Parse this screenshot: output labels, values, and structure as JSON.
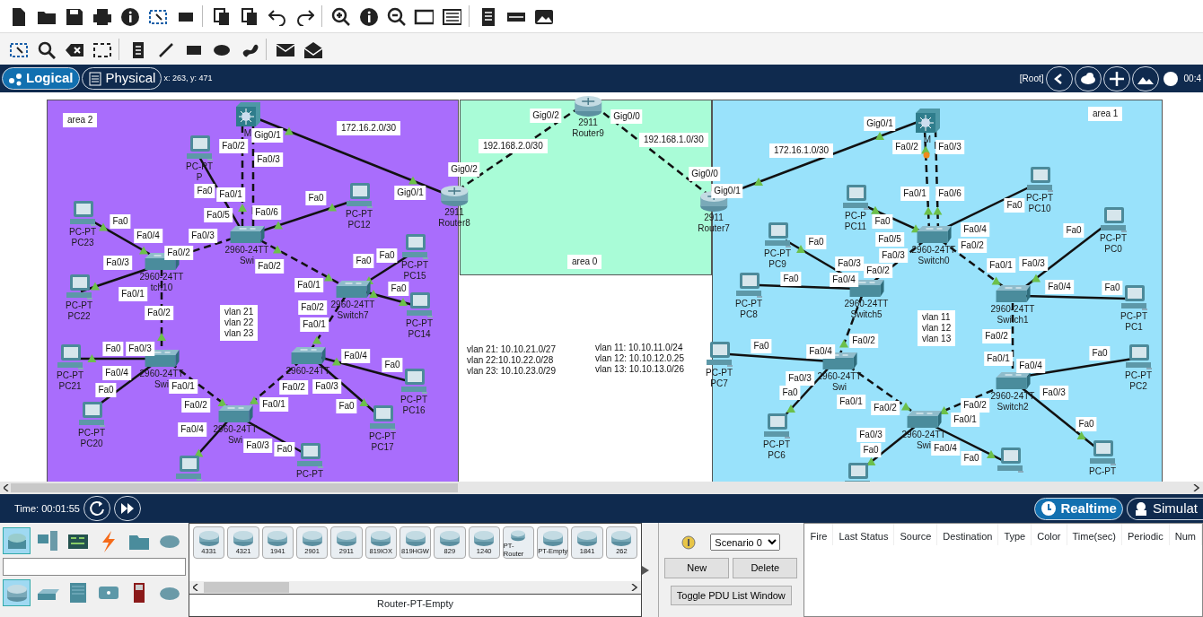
{
  "workspace_tabs": [
    {
      "label": "Logical",
      "selected": true
    },
    {
      "label": "Physical",
      "selected": false
    }
  ],
  "coordinates": "x: 263, y: 471",
  "root_label": "[Root]",
  "clock": "00:4",
  "canvas": {
    "areas": [
      {
        "color": "#a96dfc"
      },
      {
        "color": "#a9fcd7"
      },
      {
        "color": "#99e2fb"
      }
    ],
    "notes": [
      {
        "lines": [
          "area 2"
        ]
      },
      {
        "lines": [
          "172.16.2.0/30"
        ]
      },
      {
        "lines": [
          "vlan 21",
          "vlan 22",
          "vlan 23"
        ]
      },
      {
        "lines": [
          "192.168.2.0/30"
        ]
      },
      {
        "lines": [
          "192.168.1.0/30"
        ]
      },
      {
        "lines": [
          "area 0"
        ]
      },
      {
        "lines": [
          "vlan 21: 10.10.21.0/27",
          "vlan 22:10.10.22.0/28",
          "vlan 23: 10.10.23.0/29"
        ]
      },
      {
        "lines": [
          "vlan 11: 10.10.11.0/24",
          "vlan 12: 10.10.12.0.25",
          "vlan 13: 10.10.13.0/26"
        ]
      },
      {
        "lines": [
          "172.16.1.0/30"
        ]
      },
      {
        "lines": [
          "area 1"
        ]
      },
      {
        "lines": [
          "vlan 11",
          "vlan 12",
          "vlan 13"
        ]
      }
    ],
    "devices": [
      {
        "kind": "multilayer",
        "labels": [
          "M"
        ]
      },
      {
        "kind": "pc",
        "labels": [
          "PC-PT",
          "P"
        ]
      },
      {
        "kind": "pc",
        "labels": [
          "PC-PT",
          "PC12"
        ]
      },
      {
        "kind": "pc",
        "labels": [
          "PC-PT",
          "PC23"
        ]
      },
      {
        "kind": "switch",
        "labels": [
          "2960-24TT",
          "Swi"
        ]
      },
      {
        "kind": "switch",
        "labels": [
          "2960-24TT",
          "tch10"
        ]
      },
      {
        "kind": "pc",
        "labels": [
          "PC-PT",
          "PC22"
        ]
      },
      {
        "kind": "pc",
        "labels": [
          "PC-PT",
          "PC15"
        ]
      },
      {
        "kind": "switch",
        "labels": [
          "2960-24TT",
          "Switch7"
        ]
      },
      {
        "kind": "pc",
        "labels": [
          "PC-PT",
          "PC14"
        ]
      },
      {
        "kind": "pc",
        "labels": [
          "PC-PT",
          "PC21"
        ]
      },
      {
        "kind": "switch",
        "labels": [
          "2960-24TT",
          "Swi"
        ]
      },
      {
        "kind": "switch",
        "labels": [
          "2960-24TT"
        ]
      },
      {
        "kind": "pc",
        "labels": [
          "PC-PT",
          "PC16"
        ]
      },
      {
        "kind": "pc",
        "labels": [
          "PC-PT",
          "PC20"
        ]
      },
      {
        "kind": "switch",
        "labels": [
          "2960-24TT",
          "Swi"
        ]
      },
      {
        "kind": "pc",
        "labels": [
          "PC-PT",
          "PC17"
        ]
      },
      {
        "kind": "pc"
      },
      {
        "kind": "pc",
        "labels": [
          "PC-PT"
        ]
      },
      {
        "kind": "router",
        "labels": [
          "2911",
          "Router9"
        ]
      },
      {
        "kind": "router",
        "labels": [
          "2911",
          "Router8"
        ]
      },
      {
        "kind": "router",
        "labels": [
          "2911",
          "Router7"
        ]
      },
      {
        "kind": "multilayer",
        "labels": [
          "M"
        ]
      },
      {
        "kind": "pc",
        "labels": [
          "PC-P",
          "PC11"
        ]
      },
      {
        "kind": "pc",
        "labels": [
          "PC-PT",
          "PC10"
        ]
      },
      {
        "kind": "switch",
        "labels": [
          "2960-24TT",
          "Switch0"
        ]
      },
      {
        "kind": "pc",
        "labels": [
          "PC-PT",
          "PC0"
        ]
      },
      {
        "kind": "pc",
        "labels": [
          "PC-PT",
          "PC9"
        ]
      },
      {
        "kind": "pc",
        "labels": [
          "PC-PT",
          "PC8"
        ]
      },
      {
        "kind": "switch",
        "labels": [
          "2960-24TT",
          "Switch5"
        ]
      },
      {
        "kind": "switch",
        "labels": [
          "2960-24TT",
          "Switch1"
        ]
      },
      {
        "kind": "pc",
        "labels": [
          "PC-PT",
          "PC1"
        ]
      },
      {
        "kind": "pc",
        "labels": [
          "PC-PT",
          "PC7"
        ]
      },
      {
        "kind": "switch",
        "labels": [
          "2960-24TT",
          "Swi"
        ]
      },
      {
        "kind": "switch",
        "labels": [
          "2960-24TT",
          "Switch2"
        ]
      },
      {
        "kind": "pc",
        "labels": [
          "PC-PT",
          "PC2"
        ]
      },
      {
        "kind": "switch",
        "labels": [
          "2960-24TT",
          "Swi"
        ]
      },
      {
        "kind": "pc",
        "labels": [
          "PC-PT",
          "PC6"
        ]
      },
      {
        "kind": "pc"
      },
      {
        "kind": "pc"
      },
      {
        "kind": "pc",
        "labels": [
          "PC-PT"
        ]
      }
    ],
    "ports": [
      "Fa0/2",
      "Gig0/1",
      "Fa0/3",
      "Fa0",
      "Fa0/1",
      "Fa0/5",
      "Fa0/6",
      "Fa0",
      "Fa0",
      "Fa0/4",
      "Fa0/3",
      "Fa0/2",
      "Fa0/3",
      "Fa0/2",
      "Fa0/1",
      "Fa0/1",
      "Fa0",
      "Fa0",
      "Fa0",
      "Fa0/2",
      "Fa0/2",
      "Fa0/1",
      "Fa0",
      "Fa0/3",
      "Fa0/4",
      "Fa0",
      "Fa0/1",
      "Fa0/4",
      "Fa0",
      "Fa0/2",
      "Fa0/3",
      "Fa0/2",
      "Fa0/1",
      "Fa0",
      "Fa0/4",
      "Fa0/3",
      "Fa0",
      "Gig0/1",
      "Gig0/2",
      "Gig0/0",
      "Gig0/2",
      "Gig0/0",
      "Gig0/1",
      "Gig0/1",
      "Fa0/2",
      "Fa0/3",
      "Fa0/1",
      "Fa0/6",
      "Fa0",
      "Fa0/5",
      "Fa0",
      "Fa0/4",
      "Fa0/2",
      "Fa0/3",
      "Fa0/2",
      "Fa0",
      "Fa0",
      "Fa0/3",
      "Fa0/1",
      "Fa0/3",
      "Fa0/4",
      "Fa0",
      "Fa0/4",
      "Fa0",
      "Fa0/2",
      "Fa0",
      "Fa0/4",
      "Fa0/3",
      "Fa0",
      "Fa0/1",
      "Fa0/2",
      "Fa0/1",
      "Fa0/4",
      "Fa0/2",
      "Fa0/3",
      "Fa0",
      "Fa0/2",
      "Fa0/1",
      "Fa0",
      "Fa0/3",
      "Fa0",
      "Fa0/4",
      "Fa0"
    ]
  },
  "time_bar": {
    "time": "Time: 00:01:55",
    "modes": [
      {
        "label": "Realtime",
        "selected": true
      },
      {
        "label": "Simulat",
        "selected": false
      }
    ]
  },
  "device_categories": [
    {
      "selected": true
    },
    {
      "selected": false
    },
    {
      "selected": false
    },
    {
      "selected": false
    },
    {
      "selected": false
    },
    {
      "selected": false
    }
  ],
  "device_subcategories": [
    {
      "selected": true
    },
    {
      "selected": false
    },
    {
      "selected": false
    },
    {
      "selected": false
    },
    {
      "selected": false
    },
    {
      "selected": false
    }
  ],
  "device_models": [
    "4331",
    "4321",
    "1941",
    "2901",
    "2911",
    "819IOX",
    "819HGW",
    "829",
    "1240",
    "PT-Router",
    "PT-Empty",
    "1841",
    "262"
  ],
  "selected_model": "Router-PT-Empty",
  "scenario": {
    "value": "Scenario 0",
    "buttons": [
      "New",
      "Delete",
      "Toggle PDU List Window"
    ]
  },
  "pdu_columns": [
    "Fire",
    "Last Status",
    "Source",
    "Destination",
    "Type",
    "Color",
    "Time(sec)",
    "Periodic",
    "Num"
  ]
}
